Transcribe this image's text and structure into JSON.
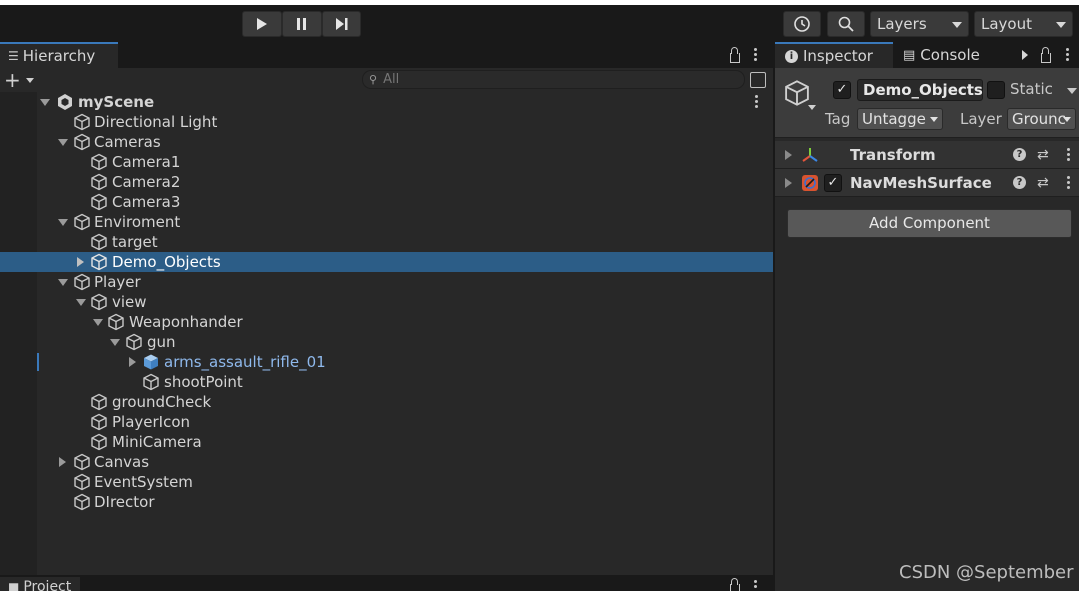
{
  "toolbar": {
    "play_icon": "play-icon",
    "pause_icon": "pause-icon",
    "step_icon": "step-icon",
    "history_icon": "history-icon",
    "search_icon": "search-icon",
    "layers_label": "Layers",
    "layout_label": "Layout"
  },
  "hierarchy": {
    "tab_label": "Hierarchy",
    "search_placeholder": "All",
    "rows": [
      {
        "label": "myScene"
      },
      {
        "label": "Directional Light"
      },
      {
        "label": "Cameras"
      },
      {
        "label": "Camera1"
      },
      {
        "label": "Camera2"
      },
      {
        "label": "Camera3"
      },
      {
        "label": "Enviroment"
      },
      {
        "label": "target"
      },
      {
        "label": "Demo_Objects"
      },
      {
        "label": "Player"
      },
      {
        "label": "view"
      },
      {
        "label": "Weaponhander"
      },
      {
        "label": "gun"
      },
      {
        "label": "arms_assault_rifle_01"
      },
      {
        "label": "shootPoint"
      },
      {
        "label": "groundCheck"
      },
      {
        "label": "PlayerIcon"
      },
      {
        "label": "MiniCamera"
      },
      {
        "label": "Canvas"
      },
      {
        "label": "EventSystem"
      },
      {
        "label": "DIrector"
      }
    ]
  },
  "project": {
    "tab_label": "Project"
  },
  "inspector": {
    "tabs": [
      {
        "label": "Inspector"
      },
      {
        "label": "Console"
      }
    ],
    "object_name": "Demo_Objects",
    "active_checked": true,
    "static_label": "Static",
    "static_checked": false,
    "tag_label": "Tag",
    "tag_value": "Untagge",
    "layer_label": "Layer",
    "layer_value": "Grounc",
    "components": [
      {
        "title": "Transform"
      },
      {
        "title": "NavMeshSurface"
      }
    ],
    "add_component_label": "Add Component"
  },
  "watermark": "CSDN @September",
  "colors": {
    "selection": "#2c5d87",
    "accent": "#3a79bb",
    "prefab_text": "#8fb9ec"
  }
}
